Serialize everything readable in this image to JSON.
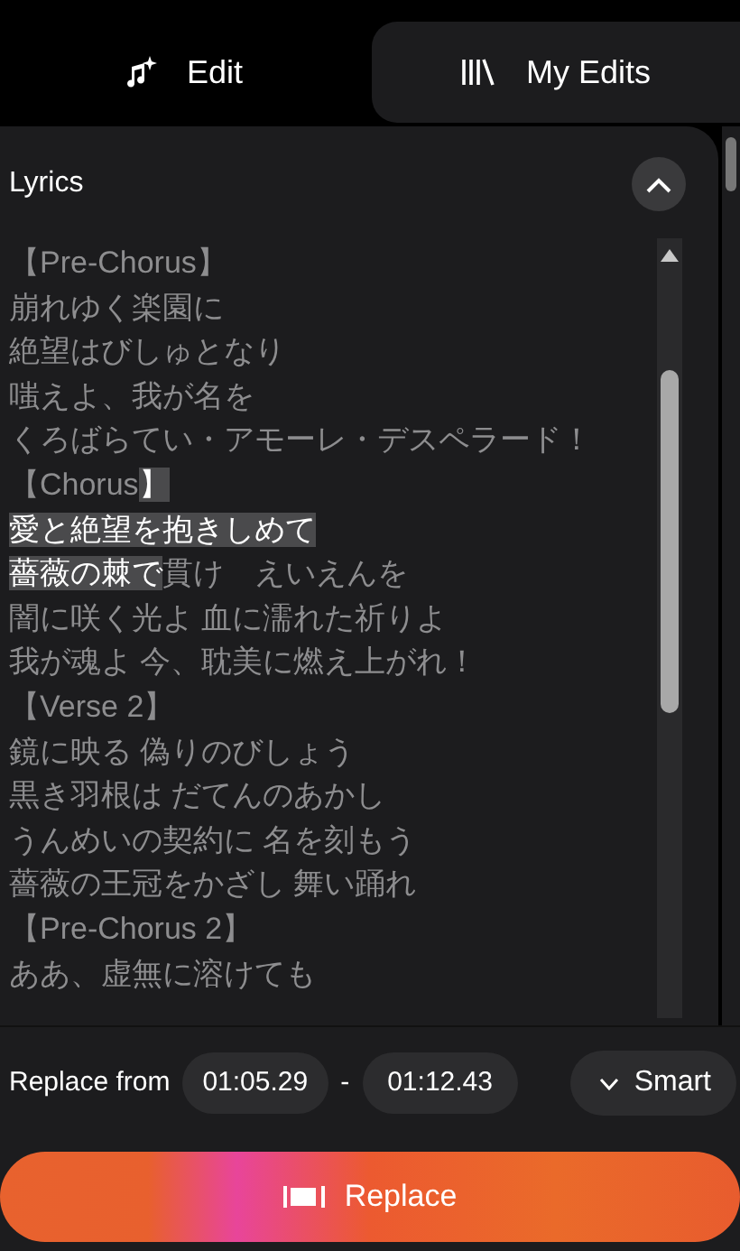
{
  "tabs": [
    {
      "label": "Edit",
      "selected": true
    },
    {
      "label": "My Edits",
      "selected": false
    }
  ],
  "lyrics": {
    "title": "Lyrics",
    "expanded": true,
    "lines": [
      {
        "parts": [
          {
            "text": "【Pre-Chorus】",
            "selected": false
          }
        ]
      },
      {
        "parts": [
          {
            "text": "崩れゆく楽園に",
            "selected": false
          }
        ]
      },
      {
        "parts": [
          {
            "text": "絶望はびしゅとなり",
            "selected": false
          }
        ]
      },
      {
        "parts": [
          {
            "text": "嗤えよ、我が名を",
            "selected": false
          }
        ]
      },
      {
        "parts": [
          {
            "text": "くろばらてい・アモーレ・デスペラード！",
            "selected": false
          }
        ]
      },
      {
        "parts": [
          {
            "text": "【Chorus",
            "selected": false
          },
          {
            "text": "】",
            "selected": true
          }
        ]
      },
      {
        "parts": [
          {
            "text": "愛と絶望を抱きしめて",
            "selected": true
          }
        ]
      },
      {
        "parts": [
          {
            "text": "薔薇の棘で",
            "selected": true
          },
          {
            "text": "貫け　えいえんを",
            "selected": false
          }
        ]
      },
      {
        "parts": [
          {
            "text": "闇に咲く光よ 血に濡れた祈りよ",
            "selected": false
          }
        ]
      },
      {
        "parts": [
          {
            "text": "我が魂よ 今、耽美に燃え上がれ！",
            "selected": false
          }
        ]
      },
      {
        "parts": [
          {
            "text": "【Verse 2】",
            "selected": false
          }
        ]
      },
      {
        "parts": [
          {
            "text": "鏡に映る 偽りのびしょう",
            "selected": false
          }
        ]
      },
      {
        "parts": [
          {
            "text": "黒き羽根は だてんのあかし",
            "selected": false
          }
        ]
      },
      {
        "parts": [
          {
            "text": "うんめいの契約に 名を刻もう",
            "selected": false
          }
        ]
      },
      {
        "parts": [
          {
            "text": "薔薇の王冠をかざし 舞い踊れ",
            "selected": false
          }
        ]
      },
      {
        "parts": [
          {
            "text": "【Pre-Chorus 2】",
            "selected": false
          }
        ]
      },
      {
        "parts": [
          {
            "text": "ああ、虚無に溶けても",
            "selected": false
          }
        ]
      }
    ]
  },
  "replace": {
    "label": "Replace from",
    "start": "01:05.29",
    "separator": "-",
    "end": "01:12.43",
    "mode": "Smart",
    "button": "Replace"
  }
}
